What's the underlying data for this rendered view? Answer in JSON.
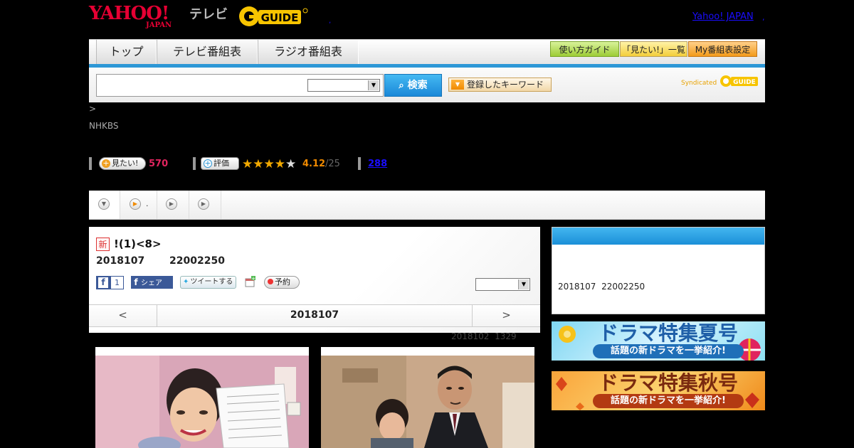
{
  "header": {
    "yahoo_logo": "YAHOO!",
    "yahoo_logo_sub": "JAPAN",
    "tv_label": "テレビ",
    "gguide_logo": "G GUIDE",
    "yahoo_japan_link": "Yahoo! JAPAN",
    "dot1": ".",
    "dot2": ","
  },
  "nav": {
    "tabs": [
      {
        "label": "トップ"
      },
      {
        "label": "テレビ番組表"
      },
      {
        "label": "ラジオ番組表"
      }
    ],
    "buttons": [
      {
        "label": "使い方ガイド"
      },
      {
        "label": "「見たい!」一覧"
      },
      {
        "label": "My番組表設定"
      }
    ]
  },
  "search": {
    "input_value": "",
    "select_value": "",
    "button_label": "検索",
    "keyword_button_label": "登録したキーワード",
    "syndicated_label": "Syndicated",
    "gguide_label": "GUIDE"
  },
  "breadcrumb": ">",
  "station": "NHKBS",
  "stats": {
    "want_label": "見たい!",
    "want_count": "570",
    "rating_label": "評価",
    "rating_value": "4.12",
    "rating_count": "/25",
    "review_count": "288",
    "stars": 4
  },
  "tabstrip": {
    "tab2_text": "."
  },
  "program": {
    "new_badge": "新",
    "title": "!(1)<8>",
    "date": "2018107",
    "time": "22002250",
    "fb_count": "1",
    "fb_share_label": "シェア",
    "tweet_label": "ツイートする",
    "reserve_label": "予約",
    "select_value": "",
    "pager_prev": "<",
    "pager_center": "2018107",
    "pager_next": ">",
    "updated_date": "2018102",
    "updated_time": "1329"
  },
  "sidebar": {
    "info_date": "2018107",
    "info_time": "22002250",
    "banner_summer_main": "ドラマ特集夏号",
    "banner_summer_sub": "話題の新ドラマを一挙紹介!",
    "banner_autumn_main": "ドラマ特集秋号",
    "banner_autumn_sub": "話題の新ドラマを一挙紹介!"
  },
  "colors": {
    "accent_blue": "#2c97d6",
    "pink": "#e0245e",
    "orange": "#f08a00",
    "link": "#1a0dff"
  }
}
